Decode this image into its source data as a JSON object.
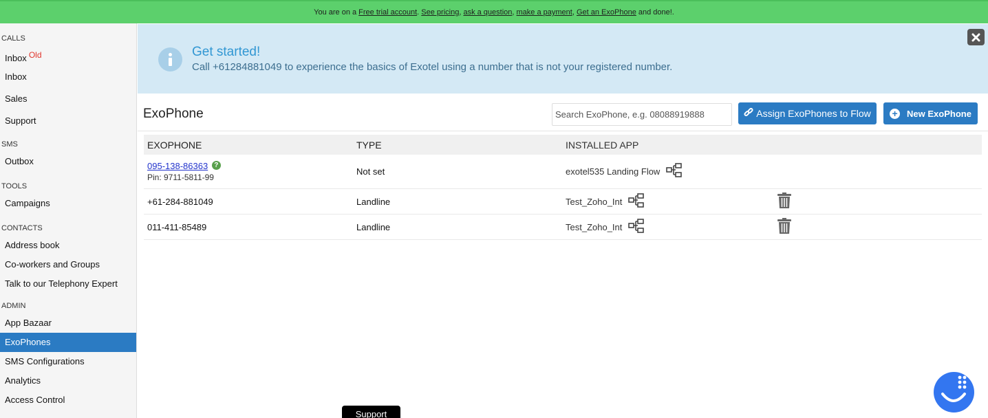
{
  "topbar": {
    "prefix": "You are on a ",
    "free_trial": "Free trial account",
    "sep1": ". ",
    "see_pricing": "See pricing",
    "sep2": ", ",
    "ask_question": "ask a question",
    "sep3": ", ",
    "make_payment": "make a payment",
    "sep4": ", ",
    "get_exophone": "Get an ExoPhone",
    "suffix": " and done!."
  },
  "sidebar": {
    "calls_label": "CALLS",
    "inbox_old": "Inbox",
    "old_badge": "Old",
    "inbox": "Inbox",
    "sales": "Sales",
    "support": "Support",
    "sms_label": "SMS",
    "outbox": "Outbox",
    "tools_label": "TOOLS",
    "campaigns": "Campaigns",
    "contacts_label": "CONTACTS",
    "address_book": "Address book",
    "coworkers": "Co-workers and Groups",
    "telephony_expert": "Talk to our Telephony Expert",
    "admin_label": "ADMIN",
    "app_bazaar": "App Bazaar",
    "exophones": "ExoPhones",
    "sms_config": "SMS Configurations",
    "analytics": "Analytics",
    "access_control": "Access Control"
  },
  "banner": {
    "title": "Get started!",
    "text": "Call +61284881049 to experience the basics of Exotel using a number that is not your registered number."
  },
  "page": {
    "title": "ExoPhone",
    "search_placeholder": "Search ExoPhone, e.g. 08088919888",
    "assign_button": "Assign ExoPhones to Flow",
    "new_button": "New ExoPhone"
  },
  "table": {
    "headers": [
      "EXOPHONE",
      "TYPE",
      "INSTALLED APP"
    ],
    "rows": [
      {
        "number": "095-138-86363",
        "pin": "Pin: 9711-5811-99",
        "type": "Not set",
        "app": "exotel535 Landing Flow"
      },
      {
        "number": "+61-284-881049",
        "type": "Landline",
        "app": "Test_Zoho_Int"
      },
      {
        "number": "011-411-85489",
        "type": "Landline",
        "app": "Test_Zoho_Int"
      }
    ]
  },
  "support_tab": "Support",
  "colors": {
    "topbar": "#5cd06c",
    "accent": "#2b7bc3",
    "banner_bg": "#d4e9f5",
    "banner_title": "#3197d3",
    "chat": "#3376f0"
  }
}
